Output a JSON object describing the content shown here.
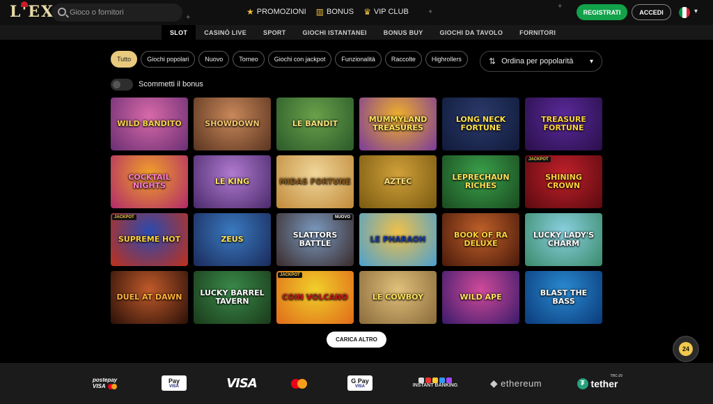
{
  "header": {
    "logo": "L'EX",
    "search_placeholder": "Gioco o fornitori",
    "nav": [
      {
        "label": "PROMOZIONI",
        "icon": "star-icon",
        "glyph": "★"
      },
      {
        "label": "BONUS",
        "icon": "gift-icon",
        "glyph": "▥"
      },
      {
        "label": "VIP CLUB",
        "icon": "crown-icon",
        "glyph": "♛"
      }
    ],
    "register_label": "REGISTRATI",
    "login_label": "ACCEDI",
    "language_flag": "italy-flag-icon"
  },
  "categories": [
    "SLOT",
    "CASINÒ LIVE",
    "SPORT",
    "GIOCHI ISTANTANEI",
    "BONUS BUY",
    "GIOCHI DA TAVOLO",
    "FORNITORI"
  ],
  "active_category": "SLOT",
  "filters": [
    "Tutto",
    "Giochi popolari",
    "Nuovo",
    "Torneo",
    "Giochi con jackpot",
    "Funzionalità",
    "Raccolte",
    "Highrollers"
  ],
  "active_filter": "Tutto",
  "sort_label": "Ordina per popolarità",
  "bonus_toggle_label": "Scommetti il bonus",
  "bonus_toggle_on": false,
  "games": [
    {
      "title": "Wild Bandito",
      "colors": [
        "#d86aa8",
        "#6a2e73"
      ],
      "text": "#f5d34a"
    },
    {
      "title": "Showdown",
      "colors": [
        "#c8885a",
        "#5a3420"
      ],
      "text": "#f5c76a"
    },
    {
      "title": "Le Bandit",
      "colors": [
        "#6aa04a",
        "#2b5a2a"
      ],
      "text": "#f5e07a"
    },
    {
      "title": "Mummyland Treasures",
      "colors": [
        "#f0b02a",
        "#7a3a9a"
      ],
      "text": "#ffe35a"
    },
    {
      "title": "Long Neck Fortune",
      "colors": [
        "#2a3a6a",
        "#111a3a"
      ],
      "text": "#ffe04a"
    },
    {
      "title": "Treasure Fortune",
      "colors": [
        "#5a2a9a",
        "#2a0f4a"
      ],
      "text": "#ffd23a"
    },
    {
      "title": "Cocktail Nights",
      "colors": [
        "#f0a02a",
        "#b02a6a"
      ],
      "text": "#ff7ad0"
    },
    {
      "title": "Le King",
      "colors": [
        "#b07ad0",
        "#4a2a6a"
      ],
      "text": "#ffe25a"
    },
    {
      "title": "Midas Fortune",
      "colors": [
        "#f0d69a",
        "#c08a3a"
      ],
      "text": "#8a5a1a"
    },
    {
      "title": "Aztec",
      "colors": [
        "#d0a03a",
        "#7a5a10"
      ],
      "text": "#ffe27a"
    },
    {
      "title": "Leprechaun Riches",
      "colors": [
        "#3aa04a",
        "#1a4a20"
      ],
      "text": "#ffe25a"
    },
    {
      "title": "Shining Crown",
      "colors": [
        "#c0202a",
        "#5a0a10"
      ],
      "text": "#ffd23a",
      "badge": "JACKPOT"
    },
    {
      "title": "Supreme Hot",
      "colors": [
        "#2a4ab0",
        "#c0301a"
      ],
      "text": "#ffd23a",
      "badge": "JACKPOT"
    },
    {
      "title": "Zeus",
      "colors": [
        "#3a7ac0",
        "#1a2a5a"
      ],
      "text": "#ffe25a"
    },
    {
      "title": "Slattors Battle",
      "colors": [
        "#7a9ac0",
        "#3a2a2a"
      ],
      "text": "#ffffff",
      "new": "NUOVO"
    },
    {
      "title": "Le Pharaoh",
      "colors": [
        "#f0c04a",
        "#4aa0d0"
      ],
      "text": "#1a3a9a"
    },
    {
      "title": "Book of Ra Deluxe",
      "colors": [
        "#c0602a",
        "#4a1a0a"
      ],
      "text": "#ffd23a"
    },
    {
      "title": "Lucky Lady's Charm",
      "colors": [
        "#8ad0e0",
        "#3a8a6a"
      ],
      "text": "#ffffff"
    },
    {
      "title": "Duel at Dawn",
      "colors": [
        "#c05a2a",
        "#2a1008"
      ],
      "text": "#ffb03a"
    },
    {
      "title": "Lucky Barrel Tavern",
      "colors": [
        "#3a8a4a",
        "#1a3a1a"
      ],
      "text": "#ffffff"
    },
    {
      "title": "Coin Volcano",
      "colors": [
        "#f0d02a",
        "#e06a1a"
      ],
      "text": "#c01a1a",
      "badge": "JACKPOT"
    },
    {
      "title": "Le Cowboy",
      "colors": [
        "#e0c07a",
        "#8a6a3a"
      ],
      "text": "#ffe25a"
    },
    {
      "title": "Wild Ape",
      "colors": [
        "#d04a9a",
        "#3a1a6a"
      ],
      "text": "#ffe25a"
    },
    {
      "title": "Blast the Bass",
      "colors": [
        "#2a8ad0",
        "#0a3a7a"
      ],
      "text": "#ffffff"
    }
  ],
  "load_more_label": "CARICA ALTRO",
  "support_label": "24",
  "payments": {
    "postepay_top": "postepay",
    "postepay_bottom": "VISA",
    "applepay_top": " Pay",
    "applepay_bottom": "VISA",
    "visa": "VISA",
    "googlepay_top": "G Pay",
    "googlepay_bottom": "VISA",
    "instant_banking": "INSTANT BANKING",
    "ethereum": "ethereum",
    "tether": "tether",
    "tether_sub": "TRC-20"
  },
  "colors": {
    "accent_gold": "#e9c97e",
    "register_green": "#11a24a",
    "jackpot_yellow": "#f2c94c"
  }
}
